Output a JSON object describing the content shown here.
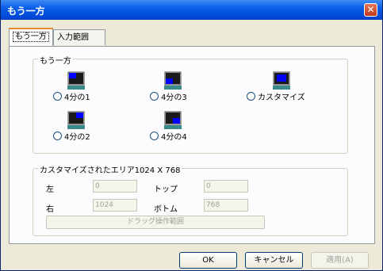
{
  "window": {
    "title": "もう一方",
    "close_glyph": "✕"
  },
  "tabs": [
    {
      "label": "もう一方",
      "active": true
    },
    {
      "label": "入力範囲",
      "active": false
    }
  ],
  "screen_group": {
    "title": "もう一方",
    "options": [
      {
        "label": "4分の1",
        "selected": false
      },
      {
        "label": "4分の3",
        "selected": false
      },
      {
        "label": "カスタマイズ",
        "selected": false
      },
      {
        "label": "4分の2",
        "selected": false
      },
      {
        "label": "4分の4",
        "selected": false
      }
    ]
  },
  "custom_group": {
    "title": "カスタマイズされたエリア1024 X 768",
    "left_label": "左",
    "left_value": "0",
    "top_label": "トップ",
    "top_value": "0",
    "right_label": "右",
    "right_value": "1024",
    "bottom_label": "ボトム",
    "bottom_value": "768",
    "drag_label": "ドラッグ操作範囲"
  },
  "buttons": {
    "ok": "OK",
    "cancel": "キャンセル",
    "apply": "適用(A)"
  },
  "colors": {
    "title_bar": "#0b5ee8",
    "accent": "#e68b2c",
    "monitor_screen": "#0000ff"
  }
}
